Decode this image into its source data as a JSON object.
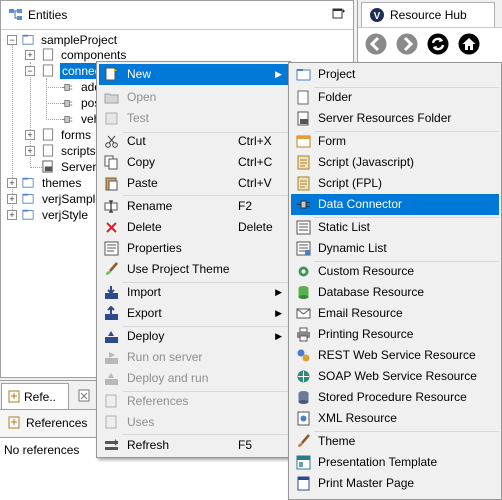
{
  "entities_panel": {
    "title": "Entities",
    "tree": [
      {
        "label": "sampleProject"
      },
      {
        "label": "components"
      },
      {
        "label": "connectors"
      },
      {
        "label": "add"
      },
      {
        "label": "pos"
      },
      {
        "label": "veh"
      },
      {
        "label": "forms"
      },
      {
        "label": "scripts"
      },
      {
        "label": "ServerR"
      },
      {
        "label": "themes"
      },
      {
        "label": "verjSamples"
      },
      {
        "label": "verjStyle"
      }
    ]
  },
  "resource_hub": {
    "title": "Resource Hub",
    "buttons": [
      "back-icon",
      "forward-icon",
      "refresh-icon",
      "home-icon"
    ]
  },
  "bottom_panel": {
    "tab1": "Refe..",
    "tab2": "",
    "subtab": "References",
    "message": "No references"
  },
  "context_menu": {
    "items": [
      {
        "label": "New",
        "shortcut": "",
        "submenu": true,
        "selected": true
      },
      {
        "label": "Open",
        "disabled": true
      },
      {
        "label": "Test",
        "disabled": true
      },
      {
        "label": "Cut",
        "shortcut": "Ctrl+X"
      },
      {
        "label": "Copy",
        "shortcut": "Ctrl+C"
      },
      {
        "label": "Paste",
        "shortcut": "Ctrl+V"
      },
      {
        "label": "Rename",
        "shortcut": "F2"
      },
      {
        "label": "Delete",
        "shortcut": "Delete"
      },
      {
        "label": "Properties"
      },
      {
        "label": "Use Project Theme"
      },
      {
        "label": "Import",
        "submenu": true
      },
      {
        "label": "Export",
        "submenu": true
      },
      {
        "label": "Deploy",
        "submenu": true
      },
      {
        "label": "Run on server",
        "disabled": true
      },
      {
        "label": "Deploy and run",
        "disabled": true
      },
      {
        "label": "References",
        "disabled": true
      },
      {
        "label": "Uses",
        "disabled": true
      },
      {
        "label": "Refresh",
        "shortcut": "F5"
      }
    ]
  },
  "submenu": {
    "items": [
      {
        "label": "Project"
      },
      {
        "label": "Folder"
      },
      {
        "label": "Server Resources Folder"
      },
      {
        "label": "Form"
      },
      {
        "label": "Script (Javascript)"
      },
      {
        "label": "Script (FPL)"
      },
      {
        "label": "Data Connector",
        "selected": true
      },
      {
        "label": "Static List"
      },
      {
        "label": "Dynamic List"
      },
      {
        "label": "Custom Resource"
      },
      {
        "label": "Database Resource"
      },
      {
        "label": "Email Resource"
      },
      {
        "label": "Printing Resource"
      },
      {
        "label": "REST Web Service Resource"
      },
      {
        "label": "SOAP Web Service Resource"
      },
      {
        "label": "Stored Procedure Resource"
      },
      {
        "label": "XML Resource"
      },
      {
        "label": "Theme"
      },
      {
        "label": "Presentation Template"
      },
      {
        "label": "Print Master Page"
      }
    ]
  },
  "colors": {
    "selection": "#0078d7",
    "hub_button": "#8a8a8a",
    "hub_button_dark": "#000000"
  }
}
